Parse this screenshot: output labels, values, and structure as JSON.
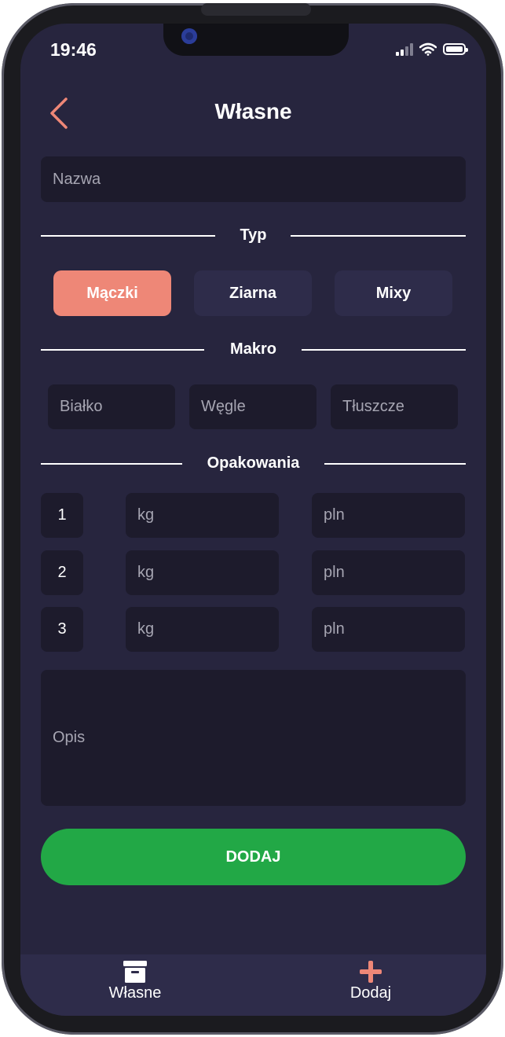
{
  "status_bar": {
    "time": "19:46"
  },
  "header": {
    "title": "Własne"
  },
  "form": {
    "name_placeholder": "Nazwa",
    "type_section": "Typ",
    "types": [
      "Mączki",
      "Ziarna",
      "Mixy"
    ],
    "selected_type": "Mączki",
    "macro_section": "Makro",
    "macro_fields": [
      "Białko",
      "Węgle",
      "Tłuszcze"
    ],
    "packaging_section": "Opakowania",
    "packages": [
      {
        "number": "1",
        "weight_placeholder": "kg",
        "price_placeholder": "pln"
      },
      {
        "number": "2",
        "weight_placeholder": "kg",
        "price_placeholder": "pln"
      },
      {
        "number": "3",
        "weight_placeholder": "kg",
        "price_placeholder": "pln"
      }
    ],
    "description_placeholder": "Opis",
    "submit_label": "DODAJ"
  },
  "tab_bar": {
    "items": [
      {
        "label": "Własne",
        "icon": "archive-box-icon"
      },
      {
        "label": "Dodaj",
        "icon": "plus-icon"
      }
    ]
  },
  "colors": {
    "background": "#27253e",
    "field": "#1d1b2c",
    "accent": "#ee8777",
    "button_inactive": "#2e2c4a",
    "submit": "#22a846"
  }
}
